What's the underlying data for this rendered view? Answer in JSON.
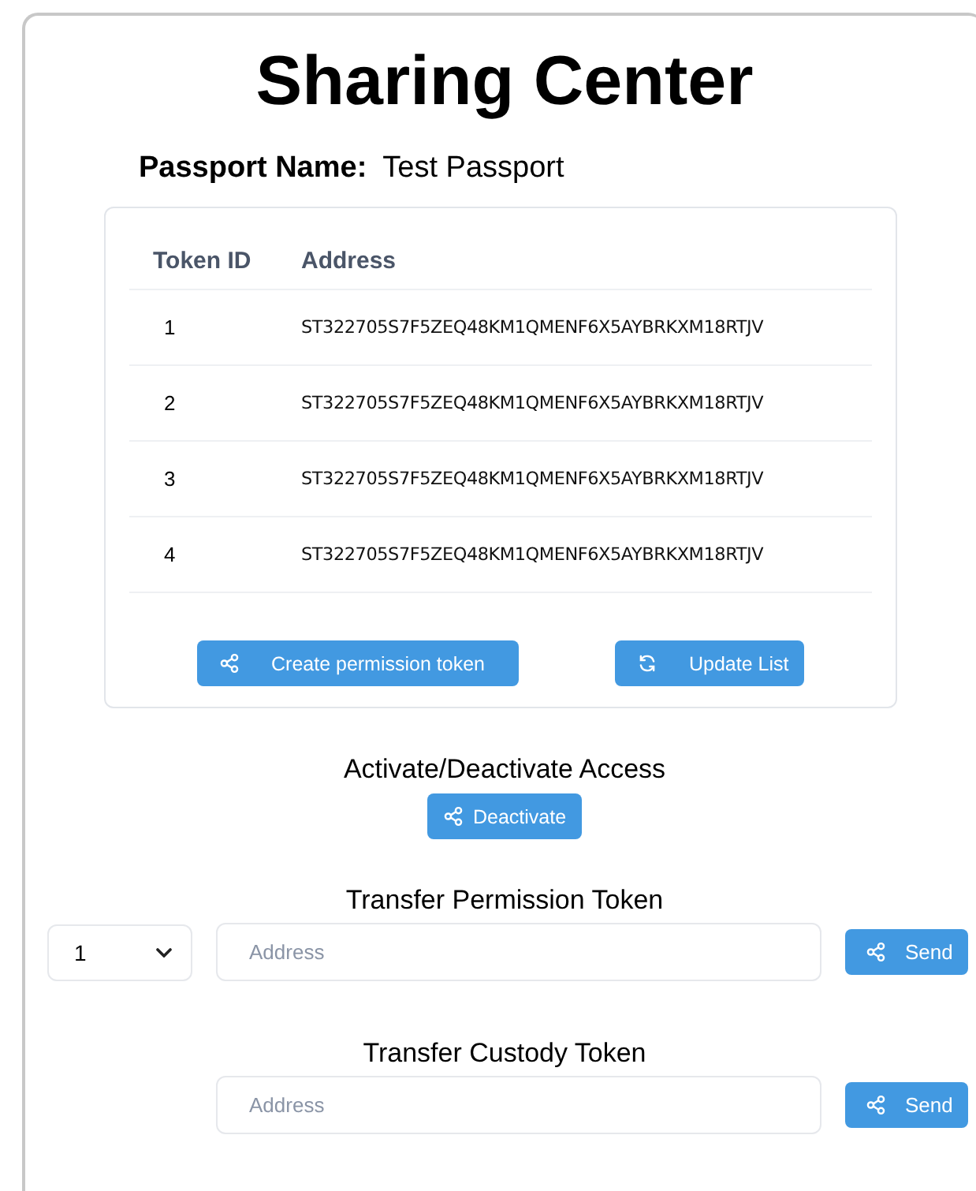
{
  "title": "Sharing Center",
  "passport": {
    "label": "Passport Name:",
    "value": "Test Passport"
  },
  "table": {
    "columns": [
      "Token ID",
      "Address"
    ],
    "rows": [
      {
        "id": "1",
        "address": "ST322705S7F5ZEQ48KM1QMENF6X5AYBRKXM18RTJV"
      },
      {
        "id": "2",
        "address": "ST322705S7F5ZEQ48KM1QMENF6X5AYBRKXM18RTJV"
      },
      {
        "id": "3",
        "address": "ST322705S7F5ZEQ48KM1QMENF6X5AYBRKXM18RTJV"
      },
      {
        "id": "4",
        "address": "ST322705S7F5ZEQ48KM1QMENF6X5AYBRKXM18RTJV"
      }
    ],
    "buttons": [
      {
        "label": "Create permission token"
      },
      {
        "label": "Update List"
      }
    ]
  },
  "access": {
    "heading": "Activate/Deactivate Access",
    "button": {
      "label": "Deactivate"
    }
  },
  "transfer_permission": {
    "heading": "Transfer Permission Token",
    "select": {
      "value": "1"
    },
    "placeholder": "Address",
    "button": {
      "label": "Send"
    }
  },
  "transfer_custody": {
    "heading": "Transfer Custody Token",
    "placeholder": "Address",
    "button": {
      "label": "Send"
    }
  }
}
